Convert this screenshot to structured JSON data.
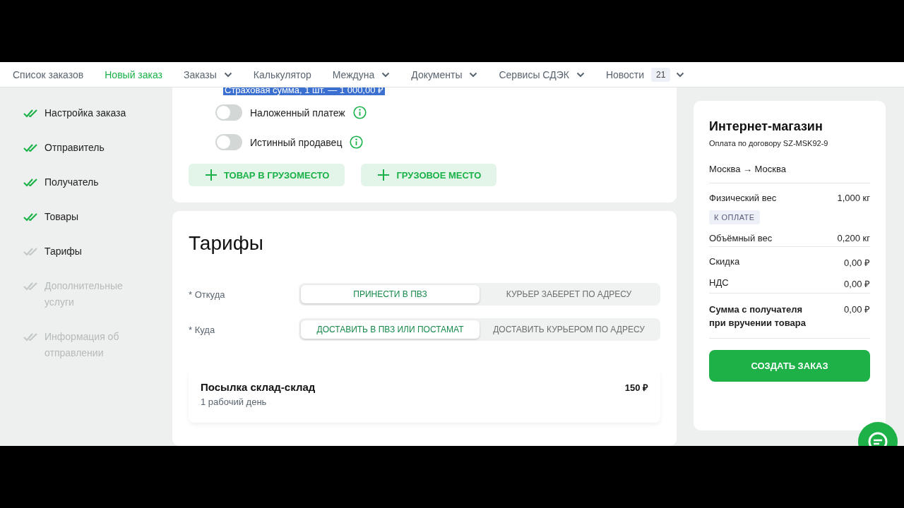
{
  "nav": [
    {
      "label": "Список заказов",
      "selected": false,
      "dropdown": false
    },
    {
      "label": "Новый заказ",
      "selected": true,
      "dropdown": false
    },
    {
      "label": "Заказы",
      "selected": false,
      "dropdown": true
    },
    {
      "label": "Калькулятор",
      "selected": false,
      "dropdown": false
    },
    {
      "label": "Междуна",
      "selected": false,
      "dropdown": true
    },
    {
      "label": "Документы",
      "selected": false,
      "dropdown": true
    },
    {
      "label": "Сервисы СДЭК",
      "selected": false,
      "dropdown": true
    },
    {
      "label": "Новости",
      "badge": "21",
      "selected": false,
      "dropdown": true
    }
  ],
  "steps": [
    {
      "label": "Настройка заказа",
      "completed": true,
      "disabled": false
    },
    {
      "label": "Отправитель",
      "completed": true,
      "disabled": false
    },
    {
      "label": "Получатель",
      "completed": true,
      "disabled": false
    },
    {
      "label": "Товары",
      "completed": true,
      "disabled": false
    },
    {
      "label": "Тарифы",
      "completed": false,
      "disabled": false
    },
    {
      "label": "Дополнительные услуги",
      "completed": false,
      "disabled": true
    },
    {
      "label": "Информация об отправлении",
      "completed": false,
      "disabled": true
    }
  ],
  "cargo": {
    "selected_text": "Страховая сумма, 1 шт. — 1 000,00 ₽",
    "toggles": [
      {
        "label": "Наложенный платеж",
        "on": false
      },
      {
        "label": "Истинный продавец",
        "on": false
      }
    ],
    "add_buttons": [
      "ТОВАР В ГРУЗОМЕСТО",
      "ГРУЗОВОЕ МЕСТО"
    ]
  },
  "tariffs": {
    "title": "Тарифы",
    "fields": [
      {
        "label": "* Откуда",
        "options": [
          {
            "label": "ПРИНЕСТИ В ПВЗ",
            "selected": true
          },
          {
            "label": "КУРЬЕР ЗАБЕРЕТ ПО АДРЕСУ",
            "selected": false
          }
        ]
      },
      {
        "label": "* Куда",
        "options": [
          {
            "label": "ДОСТАВИТЬ В ПВЗ ИЛИ ПОСТАМАТ",
            "selected": true
          },
          {
            "label": "ДОСТАВИТЬ КУРЬЕРОМ ПО АДРЕСУ",
            "selected": false
          }
        ]
      }
    ],
    "offer": {
      "name": "Посылка склад-склад",
      "duration": "1 рабочий день",
      "price": "150 ₽"
    }
  },
  "summary": {
    "title": "Интернет-магазин",
    "subtitle": "Оплата по договору SZ-MSK92-9",
    "route": "Москва → Москва",
    "groups": [
      [
        {
          "label": "Физический вес",
          "value": "1,000 кг",
          "tag": "К ОПЛАТЕ",
          "kind": "plain"
        },
        {
          "label": "Объёмный вес",
          "value": "0,200 кг",
          "kind": "plain"
        }
      ],
      [
        {
          "label": "Скидка",
          "value": "0,00 ₽",
          "kind": "plain"
        },
        {
          "label": "НДС",
          "value": "0,00 ₽",
          "kind": "plain"
        }
      ],
      [
        {
          "label": "Сумма с получателя при вручении товара",
          "value": "0,00 ₽",
          "kind": "total"
        }
      ]
    ],
    "button": "СОЗДАТЬ ЗАКАЗ"
  }
}
